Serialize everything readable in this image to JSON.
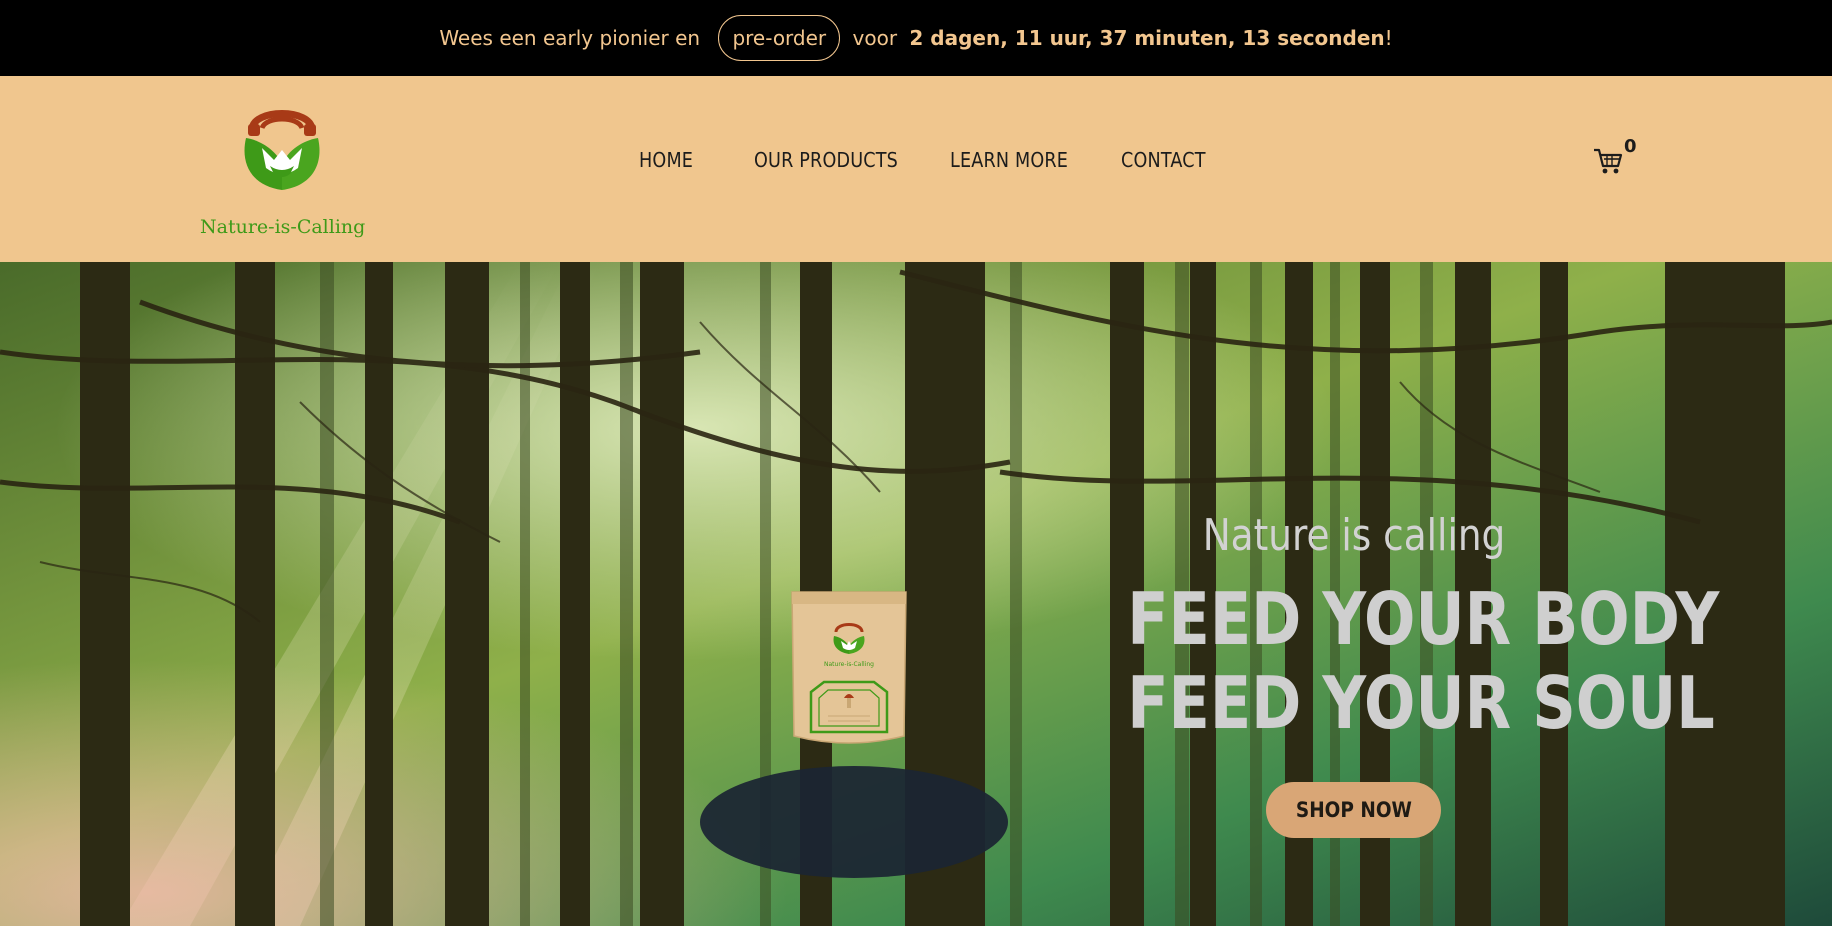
{
  "announcement": {
    "prefix": "Wees een early pionier en",
    "cta": "pre-order",
    "middle": "voor",
    "countdown": "2 dagen, 11 uur, 37 minuten, 13 seconden",
    "suffix": "!"
  },
  "header": {
    "logo_text": "Nature-is-Calling",
    "nav": [
      "HOME",
      "OUR PRODUCTS",
      "LEARN MORE",
      "CONTACT"
    ],
    "cart_count": "0"
  },
  "hero": {
    "tagline": "Nature is calling",
    "headline_line1": "FEED YOUR BODY",
    "headline_line2": "FEED YOUR SOUL",
    "cta": "SHOP NOW",
    "product_brand": "Nature-is-Calling"
  },
  "colors": {
    "announce_bg": "#000000",
    "announce_text": "#f2c68f",
    "header_bg": "#f0c68e",
    "logo_green": "#3e9a18",
    "logo_red": "#a83a17",
    "button_bg": "#d9a676"
  },
  "icons": {
    "logo": "leaf-heart-logo-icon",
    "cart": "shopping-cart-icon"
  }
}
